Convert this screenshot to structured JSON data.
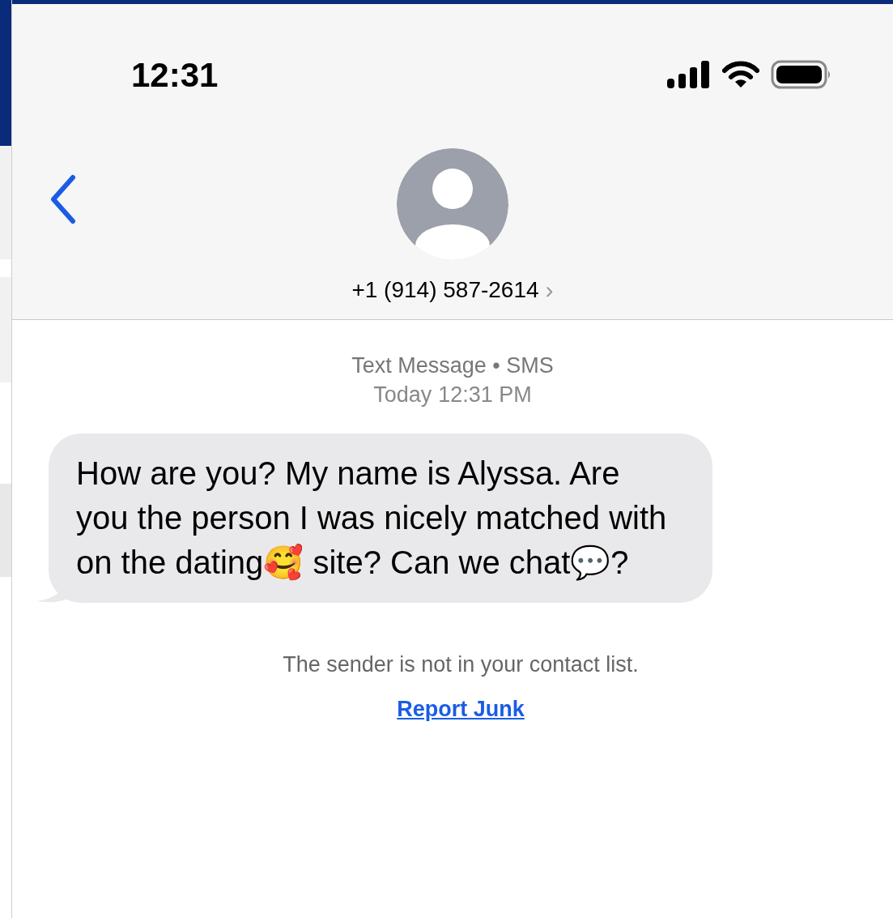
{
  "status_bar": {
    "time": "12:31"
  },
  "contact": {
    "number": "+1 (914) 587-2614",
    "chevron": "›"
  },
  "conversation": {
    "service": "Text Message • SMS",
    "timestamp_day": "Today",
    "timestamp_time": "12:31 PM",
    "messages": [
      {
        "kind": "incoming",
        "text": "How are you? My name is Alyssa. Are you the person I was nicely matched with on the dating🥰 site? Can we chat💬?"
      }
    ],
    "notice": "The sender is not in your contact list.",
    "report_link": "Report Junk"
  }
}
